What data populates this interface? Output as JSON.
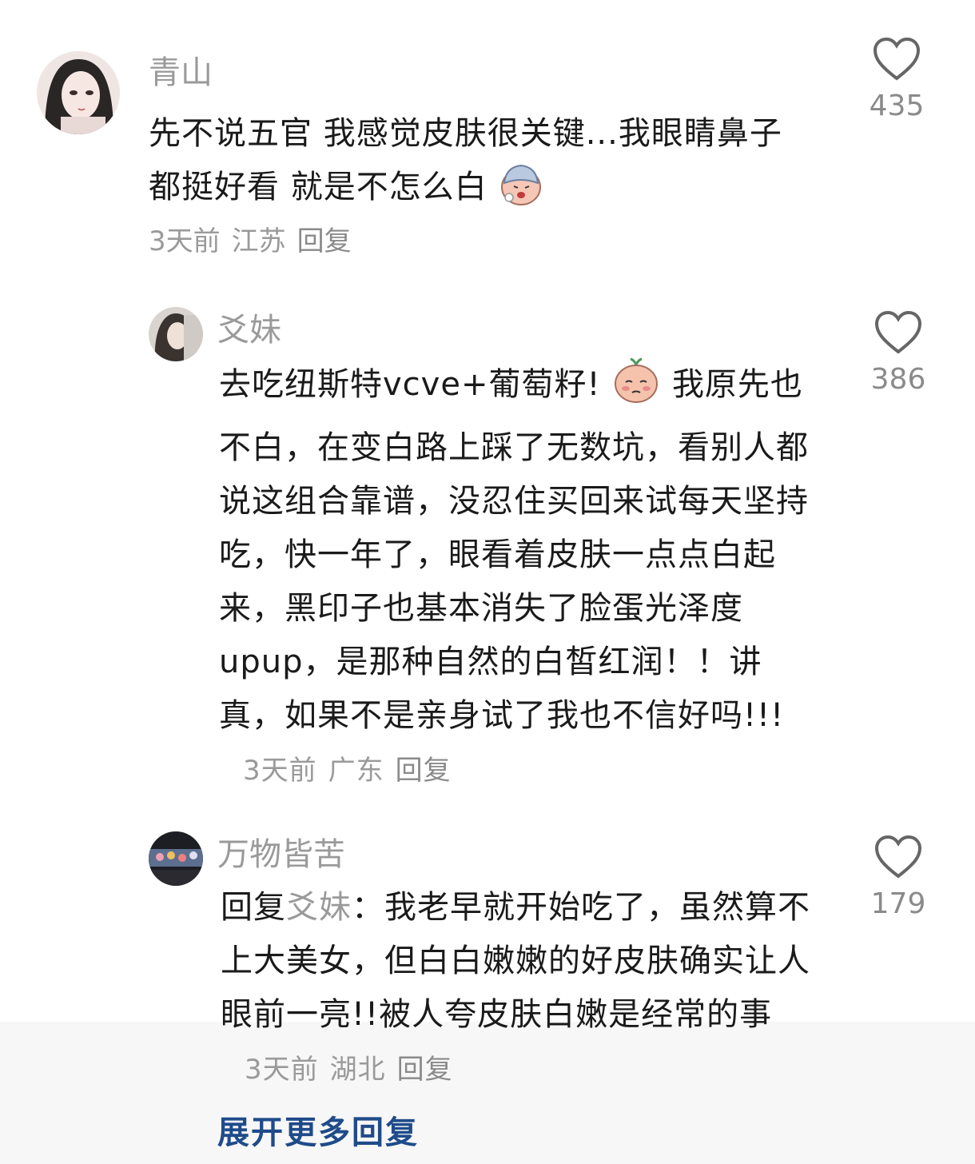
{
  "comments": [
    {
      "username": "青山",
      "text_before_emoji": "先不说五官 我感觉皮肤很关键...我眼睛鼻子都挺好看 就是不怎么白",
      "emoji": "sick-face-emoji",
      "time": "3天前",
      "location": "江苏",
      "reply_label": "回复",
      "likes": "435"
    },
    {
      "username": "爻妹",
      "text_before_emoji": "去吃纽斯特vcve+葡萄籽!",
      "emoji": "shy-face-emoji",
      "text_after_emoji": "我原先也不白，在变白路上踩了无数坑，看别人都说这组合靠谱，没忍住买回来试每天坚持吃，快一年了，眼看着皮肤一点点白起来，黑印子也基本消失了脸蛋光泽度upup，是那种自然的白皙红润！！讲真，如果不是亲身试了我也不信好吗!!!",
      "time": "3天前",
      "location": "广东",
      "reply_label": "回复",
      "likes": "386"
    },
    {
      "username": "万物皆苦",
      "reply_prefix": "回复",
      "reply_target": "爻妹",
      "colon": "：",
      "text": "我老早就开始吃了，虽然算不上大美女，但白白嫩嫩的好皮肤确实让人眼前一亮!!被人夸皮肤白嫩是经常的事",
      "time": "3天前",
      "location": "湖北",
      "reply_label": "回复",
      "likes": "179"
    }
  ],
  "expand_more": "展开更多回复",
  "colors": {
    "username": "#9a9a9a",
    "text": "#1a1a1a",
    "meta": "#9a9a9a",
    "link": "#1f4b8a"
  }
}
